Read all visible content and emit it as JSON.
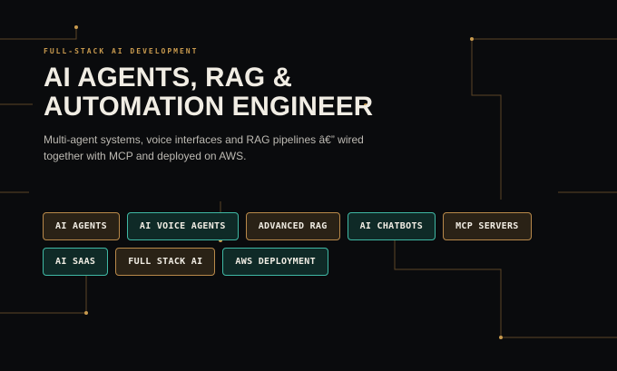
{
  "hero": {
    "eyebrow": "FULL-STACK AI DEVELOPMENT",
    "title_line1": "AI AGENTS, RAG &",
    "title_line2": "AUTOMATION ENGINEER",
    "subtitle": "Multi-agent systems, voice interfaces and RAG pipelines â€” wired together with MCP and deployed on AWS."
  },
  "tags": {
    "row1": [
      {
        "label": "AI AGENTS",
        "style": "gold"
      },
      {
        "label": "AI VOICE AGENTS",
        "style": "teal"
      },
      {
        "label": "ADVANCED RAG",
        "style": "gold"
      },
      {
        "label": "AI CHATBOTS",
        "style": "teal"
      },
      {
        "label": "MCP SERVERS",
        "style": "gold"
      }
    ],
    "row2": [
      {
        "label": "AI SAAS",
        "style": "teal"
      },
      {
        "label": "FULL STACK AI",
        "style": "gold"
      },
      {
        "label": "AWS DEPLOYMENT",
        "style": "teal"
      }
    ]
  },
  "colors": {
    "background": "#0a0b0d",
    "accent_gold": "#c89a4e",
    "accent_teal": "#3fb8a4",
    "title": "#f1ede4",
    "body_text": "#bdbab3"
  }
}
